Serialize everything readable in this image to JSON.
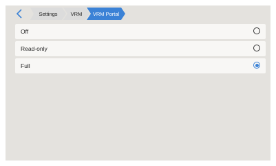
{
  "colors": {
    "accent": "#3b82d6",
    "crumb_inactive": "#dcdcdc",
    "background": "#e4e2de",
    "row": "#f8f7f5"
  },
  "breadcrumb": [
    {
      "label": "Settings",
      "active": false
    },
    {
      "label": "VRM",
      "active": false
    },
    {
      "label": "VRM Portal",
      "active": true
    }
  ],
  "options": [
    {
      "label": "Off",
      "selected": false
    },
    {
      "label": "Read-only",
      "selected": false
    },
    {
      "label": "Full",
      "selected": true
    }
  ],
  "icons": {
    "back": "chevron-left-icon"
  }
}
